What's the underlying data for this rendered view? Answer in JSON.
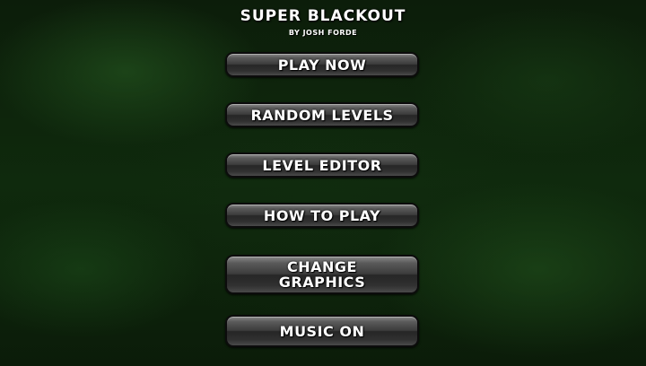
{
  "header": {
    "title": "SUPER BLACKOUT",
    "subtitle": "BY JOSH FORDE"
  },
  "menu": {
    "play_now": "PLAY NOW",
    "random_levels": "RANDOM LEVELS",
    "level_editor": "LEVEL EDITOR",
    "how_to_play": "HOW TO PLAY",
    "change_graphics": "CHANGE\nGRAPHICS",
    "music": "MUSIC ON"
  },
  "colors": {
    "background": "#0f2a0d",
    "button_face": "#3c3c3c",
    "text": "#ffffff"
  }
}
